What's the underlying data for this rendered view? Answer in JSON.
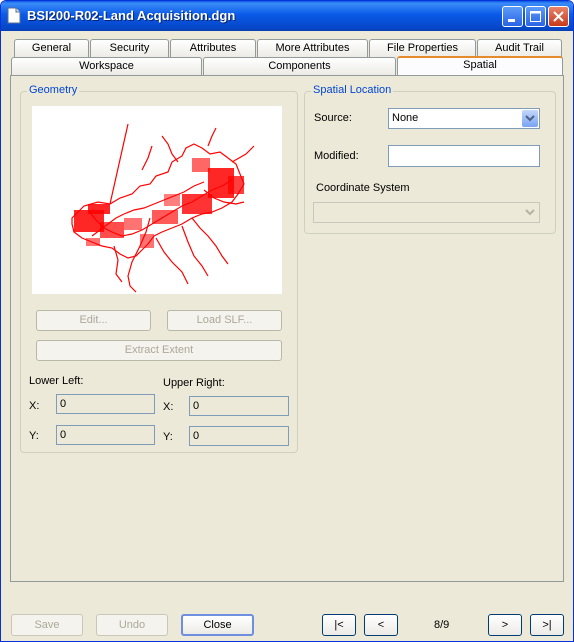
{
  "window": {
    "title": "BSI200-R02-Land Acquisition.dgn"
  },
  "tabs_row1": [
    "General",
    "Security",
    "Attributes",
    "More Attributes",
    "File Properties",
    "Audit Trail"
  ],
  "tabs_row2": [
    "Workspace",
    "Components",
    "Spatial"
  ],
  "active_tab": "Spatial",
  "geometry": {
    "title": "Geometry",
    "edit_label": "Edit...",
    "load_slf_label": "Load SLF...",
    "extract_extent_label": "Extract Extent",
    "lower_left_label": "Lower Left:",
    "upper_right_label": "Upper Right:",
    "x_label": "X:",
    "y_label": "Y:",
    "ll_x": "0",
    "ll_y": "0",
    "ur_x": "0",
    "ur_y": "0"
  },
  "spatial_location": {
    "title": "Spatial Location",
    "source_label": "Source:",
    "source_value": "None",
    "modified_label": "Modified:",
    "modified_value": "",
    "coordinate_system_label": "Coordinate System",
    "coordinate_system_value": ""
  },
  "footer": {
    "save_label": "Save",
    "undo_label": "Undo",
    "close_label": "Close",
    "first_label": "|<",
    "prev_label": "<",
    "page_indicator": "8/9",
    "next_label": ">",
    "last_label": ">|"
  },
  "colors": {
    "map_line": "#ff0000",
    "group_title": "#0046d5",
    "titlebar": "#0a5ae8"
  },
  "icons": {
    "title": "document-icon",
    "minimize": "minimize-icon",
    "maximize": "maximize-icon",
    "close": "close-icon",
    "dropdown": "chevron-down-icon"
  }
}
